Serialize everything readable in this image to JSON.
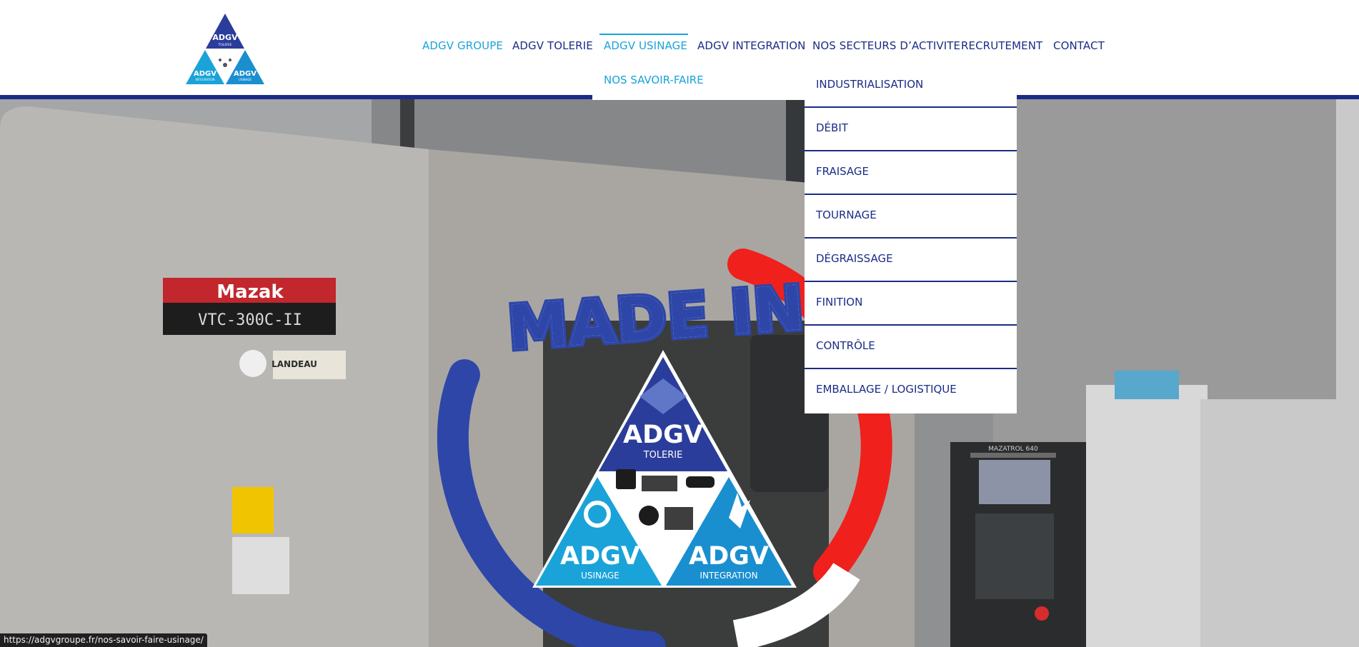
{
  "header": {
    "logo_text": {
      "top": "ADGV",
      "top_sub": "TOLERIE",
      "left": "ADGV",
      "left_sub": "INTEGRATION",
      "right": "ADGV",
      "right_sub": "USINAGE"
    },
    "nav": [
      {
        "label": "ADGV GROUPE",
        "state": "active"
      },
      {
        "label": "ADGV TOLERIE"
      },
      {
        "label": "ADGV USINAGE",
        "state": "current"
      },
      {
        "label": "ADGV INTEGRATION"
      },
      {
        "label": "NOS SECTEURS D’ACTIVITE"
      },
      {
        "label": "RECRUTEMENT"
      },
      {
        "label": "CONTACT"
      }
    ]
  },
  "dropdown": {
    "parent_item": "NOS SAVOIR-FAIRE",
    "items": [
      "INDUSTRIALISATION",
      "DÉBIT",
      "FRAISAGE",
      "TOURNAGE",
      "DÉGRAISSAGE",
      "FINITION",
      "CONTRÔLE",
      "EMBALLAGE / LOGISTIQUE"
    ]
  },
  "hero": {
    "machine_brand": "Mazak",
    "machine_model": "VTC-300C-II",
    "control_label": "MAZATROL 640",
    "sticker_label": "LANDEAU",
    "badge_title": "MADE IN",
    "badge": {
      "top": "ADGV",
      "top_sub": "TOLERIE",
      "left": "ADGV",
      "left_sub": "USINAGE",
      "right": "ADGV",
      "right_sub": "INTEGRATION"
    }
  },
  "status_url": "https://adgvgroupe.fr/nos-savoir-faire-usinage/",
  "colors": {
    "brand_blue": "#1c2c86",
    "accent_cyan": "#1aa3d9",
    "flag_red": "#f0201c"
  }
}
